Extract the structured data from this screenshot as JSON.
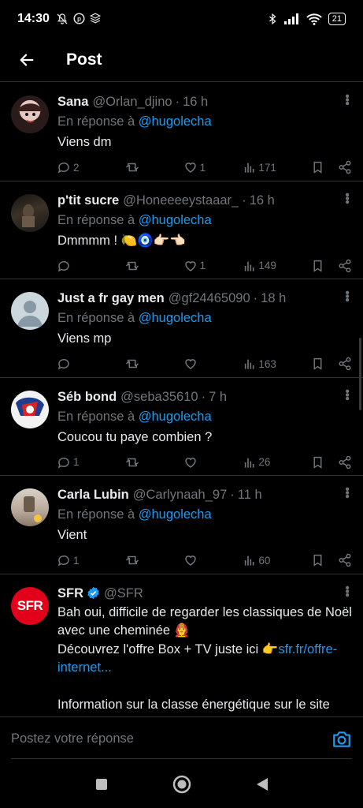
{
  "status_bar": {
    "time": "14:30",
    "battery": "21",
    "left_icons": [
      "mute-icon",
      "pinterest-icon",
      "layers-icon"
    ],
    "right_icons": [
      "bluetooth-icon",
      "signal-icon",
      "wifi-icon",
      "battery-icon"
    ]
  },
  "header": {
    "title": "Post"
  },
  "replies": [
    {
      "name": "Sana",
      "handle": "@Orlan_djino",
      "time": "16 h",
      "reply_prefix": "En réponse à",
      "reply_to": "@hugolecha",
      "text": "Viens dm",
      "counts": {
        "reply": "2",
        "retweet": "",
        "like": "1",
        "views": "171"
      },
      "avatar_color": "#7a3b3b"
    },
    {
      "name": "p'tit sucre",
      "handle": "@Honeeeeystaaar_",
      "time": "16 h",
      "reply_prefix": "En réponse à",
      "reply_to": "@hugolecha",
      "text": "Dmmmm ! 🍋🧿👉🏻👈🏻",
      "counts": {
        "reply": "",
        "retweet": "",
        "like": "1",
        "views": "149"
      },
      "avatar_color": "#2a2620"
    },
    {
      "name": "Just a fr gay men",
      "handle": "@gf24465090",
      "time": "18 h",
      "reply_prefix": "En réponse à",
      "reply_to": "@hugolecha",
      "text": "Viens mp",
      "counts": {
        "reply": "",
        "retweet": "",
        "like": "",
        "views": "163"
      },
      "avatar_color": "#ccd6dd"
    },
    {
      "name": "Séb bond",
      "handle": "@seba35610",
      "time": "7 h",
      "reply_prefix": "En réponse à",
      "reply_to": "@hugolecha",
      "text": "Coucou tu paye combien ?",
      "counts": {
        "reply": "1",
        "retweet": "",
        "like": "",
        "views": "26"
      },
      "avatar_color": "#1e3d8f"
    },
    {
      "name": "Carla Lubin",
      "handle": "@Carlynaah_97",
      "time": "11 h",
      "reply_prefix": "En réponse à",
      "reply_to": "@hugolecha",
      "text": "Vient",
      "counts": {
        "reply": "1",
        "retweet": "",
        "like": "",
        "views": "60"
      },
      "avatar_color": "#b8a89a"
    }
  ],
  "promo": {
    "name": "SFR",
    "handle": "@SFR",
    "logo_text": "SFR",
    "line1": "Bah oui, difficile de regarder les classiques de Noël avec une cheminée 👨‍🚒",
    "line2": "Découvrez l'offre Box + TV juste ici 👉",
    "link": "sfr.fr/offre-internet...",
    "line3": "Information sur la classe énergétique sur le site SFR"
  },
  "compose": {
    "placeholder": "Postez votre réponse"
  },
  "colors": {
    "accent": "#1d9bf0",
    "muted": "#71767b",
    "background": "#000000",
    "divider": "#2f3336",
    "sfr_red": "#e2001a"
  }
}
